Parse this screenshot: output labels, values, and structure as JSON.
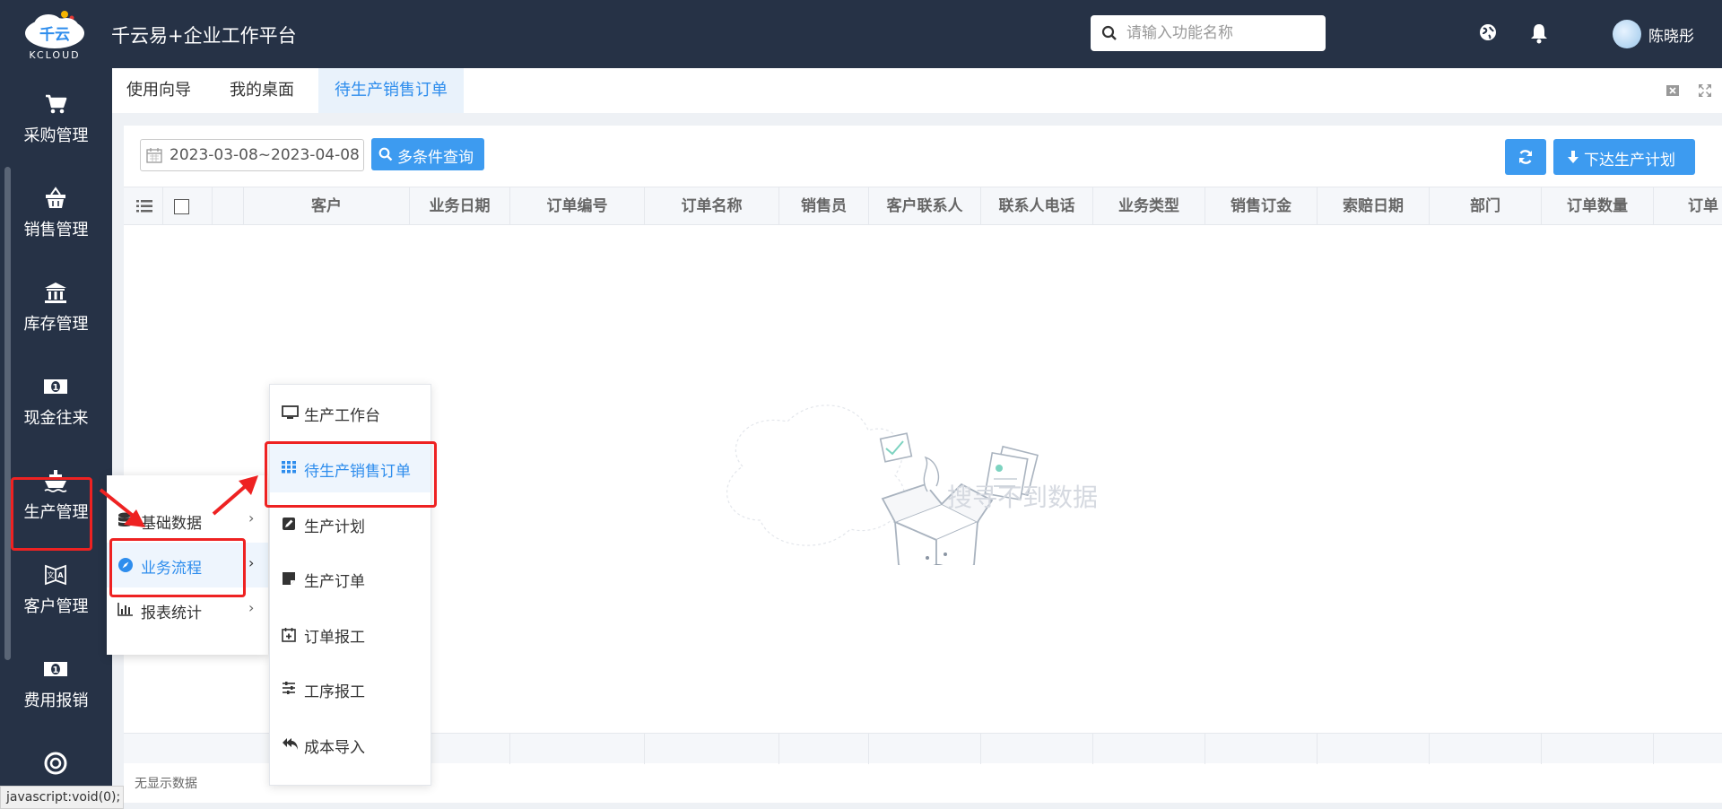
{
  "header": {
    "logo_text": "千云",
    "logo_subtext": "KCLOUD",
    "title": "千云易+企业工作平台",
    "search_placeholder": "请输入功能名称",
    "user_name": "陈晓彤"
  },
  "sidebar": {
    "items": [
      {
        "label": "采购管理",
        "icon": "cart-icon"
      },
      {
        "label": "销售管理",
        "icon": "basket-icon"
      },
      {
        "label": "库存管理",
        "icon": "bank-icon"
      },
      {
        "label": "现金往来",
        "icon": "money-icon"
      },
      {
        "label": "生产管理",
        "icon": "ship-icon",
        "active": true
      },
      {
        "label": "客户管理",
        "icon": "customer-icon"
      },
      {
        "label": "费用报销",
        "icon": "money-icon"
      }
    ]
  },
  "tabs": [
    {
      "label": "使用向导"
    },
    {
      "label": "我的桌面"
    },
    {
      "label": "待生产销售订单",
      "active": true
    }
  ],
  "toolbar": {
    "date_range": "2023-03-08~2023-04-08",
    "query_label": "多条件查询",
    "plan_label": "下达生产计划"
  },
  "grid": {
    "columns": [
      "客户",
      "业务日期",
      "订单编号",
      "订单名称",
      "销售员",
      "客户联系人",
      "联系人电话",
      "业务类型",
      "销售订金",
      "索赔日期",
      "部门",
      "订单数量",
      "订单"
    ],
    "empty_text": "搜寻不到数据",
    "footer_text": "无显示数据"
  },
  "menu_level1": [
    {
      "label": "基础数据",
      "icon": "database-icon"
    },
    {
      "label": "业务流程",
      "icon": "compass-icon",
      "active": true
    },
    {
      "label": "报表统计",
      "icon": "bar-chart-icon"
    }
  ],
  "menu_level2": [
    {
      "label": "生产工作台",
      "icon": "monitor-icon"
    },
    {
      "label": "待生产销售订单",
      "icon": "grid-icon",
      "active": true
    },
    {
      "label": "生产计划",
      "icon": "edit-icon"
    },
    {
      "label": "生产订单",
      "icon": "note-icon"
    },
    {
      "label": "订单报工",
      "icon": "calendar-plus-icon"
    },
    {
      "label": "工序报工",
      "icon": "sliders-icon"
    },
    {
      "label": "成本导入",
      "icon": "reply-all-icon"
    }
  ],
  "status_bar": "javascript:void(0);",
  "colors": {
    "header_bg": "#263246",
    "accent": "#3d9bf0",
    "highlight": "#ee2222"
  }
}
